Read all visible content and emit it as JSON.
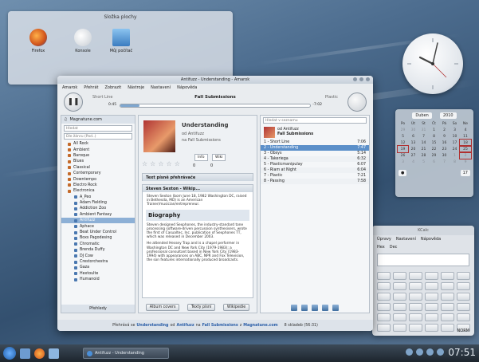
{
  "desktop": {
    "folder_view": {
      "title": "Složka plochy",
      "icons": [
        {
          "label": "Firefox",
          "icon": "firefox-icon"
        },
        {
          "label": "Konsole",
          "icon": "konsole-icon"
        },
        {
          "label": "Můj počítač",
          "icon": "computer-icon"
        }
      ]
    }
  },
  "calendar": {
    "month": "Duben",
    "year": "2010",
    "weekdays": [
      "Po",
      "Út",
      "St",
      "Čt",
      "Pá",
      "So",
      "Ne"
    ],
    "weeks": [
      [
        "29",
        "30",
        "31",
        "1",
        "2",
        "3",
        "4"
      ],
      [
        "5",
        "6",
        "7",
        "8",
        "9",
        "10",
        "11"
      ],
      [
        "12",
        "13",
        "14",
        "15",
        "16",
        "17",
        "18"
      ],
      [
        "19",
        "20",
        "21",
        "22",
        "23",
        "24",
        "25"
      ],
      [
        "26",
        "27",
        "28",
        "29",
        "30",
        "1",
        "2"
      ],
      [
        "3",
        "4",
        "5",
        "6",
        "7",
        "8",
        "9"
      ]
    ],
    "week_number": "17"
  },
  "calculator": {
    "title": "KCalc",
    "menu": [
      "Úpravy",
      "Nastavení",
      "Nápověda"
    ],
    "radio_labels": [
      "Hex",
      "Dec"
    ],
    "status": "NORM"
  },
  "amarok": {
    "window_title": "Antifuzz - Understanding - Amarok",
    "menu": [
      "Amarok",
      "Přehrát",
      "Zobrazit",
      "Nástroje",
      "Nastavení",
      "Nápověda"
    ],
    "now_playing": "Fall Submissions",
    "prev_track": "Short Line",
    "next_track": "Plastic",
    "time_elapsed": "0:45",
    "time_remaining": "-7:02",
    "progress_fraction": 0.1,
    "source_tab": "Magnatune.com",
    "search_placeholder": "Hledat",
    "sort_label": "Dle žánru (Pod..)",
    "genres": [
      "All Rock",
      "Ambient",
      "Baroque",
      "Blues",
      "Classical",
      "Contemporary",
      "Downtempo",
      "Electro Rock",
      "Electronica"
    ],
    "artists": [
      "A_Peo",
      "Adam Fielding",
      "Addiction Zoo",
      "Ambient Fantasy",
      "Antifuzz",
      "Aphace",
      "Beat Under Control",
      "Boxs Pagodesing",
      "Chromatic",
      "Brenda Duffy",
      "DJ Cow",
      "Crestorchestra",
      "Gaza",
      "Hextoulte",
      "Humanoid"
    ],
    "pane_footer": "Přehledy",
    "context": {
      "artist_heading": "Understanding",
      "by_label": "od Antifuzz",
      "album_label": "na Fall Submissions",
      "rating_value": "0",
      "play_count": "0",
      "info_tab": "Info",
      "wiki_tab": "Wiki",
      "text_player_tab": "Text písně přehrávače",
      "lyrics_bar": "Steven Sexton - Wikip...",
      "bio_title": "Biography",
      "bio_p1": "Steven Sexton (born June 18, 1982 Washington DC, raised in Bethesda, MD) is an American Trainer/musician/entrepreneur.",
      "bio_p2": "Steven designed Sexphones, the industry-standard tone processing software-driven percussion synthesisers, wrote the first of Casualtec, Inc. publication of Sexphones TT, which was released in December 2003.",
      "bio_p3": "He attended Hessey Trap and is a chapel performer in Washington DC and New York City (1979-1983); a professional consultant based in New York City (1983-1994) with appearances on ABC, NPR and Fox Television, the son features internationally produced broadcasts.",
      "buttons": [
        "Album covers",
        "Texty písní",
        "Wikipedie"
      ]
    },
    "playlist": {
      "search_placeholder": "Hledat v seznamu",
      "header_artist": "od Antifuzz",
      "header_album": "Fall Submissions",
      "tracks": [
        {
          "title": "1 - Short Line",
          "length": "7:06"
        },
        {
          "title": "2 - Understanding",
          "length": "7:47"
        },
        {
          "title": "3 - Obsys",
          "length": "5:14"
        },
        {
          "title": "4 - Takeriega",
          "length": "6:32"
        },
        {
          "title": "5 - Plasticmanipulay",
          "length": "6:07"
        },
        {
          "title": "6 - Riam at Night",
          "length": "6:04"
        },
        {
          "title": "7 - Plastic",
          "length": "7:21"
        },
        {
          "title": "8 - Passing",
          "length": "7:58"
        }
      ]
    },
    "status": {
      "prefix": "Přehrává se",
      "track": "Understanding",
      "by": "od",
      "artist": "Antifuzz",
      "on": "na",
      "album": "Fall Submissions",
      "source_prefix": "z",
      "source": "Magnatune.com",
      "count": "8 skladeb (56:31)"
    }
  },
  "taskbar": {
    "task_label": "Antifuzz - Understanding",
    "clock": "07:51"
  }
}
